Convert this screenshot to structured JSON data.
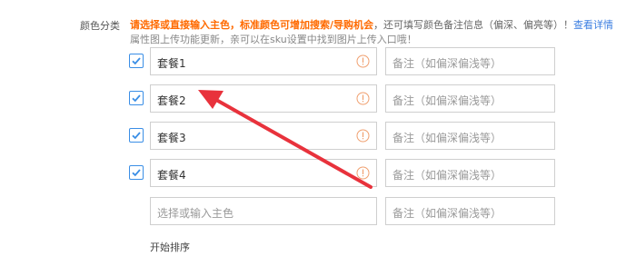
{
  "section": {
    "label": "颜色分类"
  },
  "notice": {
    "highlight": "请选择或直接输入主色，标准颜色可增加搜索/导购机会",
    "rest": "，还可填写颜色备注信息（偏深、偏亮等）！",
    "link": "查看详情",
    "line2": "属性图上传功能更新，亲可以在sku设置中找到图片上传入口哦！"
  },
  "rows": [
    {
      "checked": true,
      "value": "套餐1",
      "remark_placeholder": "备注（如偏深偏浅等）"
    },
    {
      "checked": true,
      "value": "套餐2",
      "remark_placeholder": "备注（如偏深偏浅等）"
    },
    {
      "checked": true,
      "value": "套餐3",
      "remark_placeholder": "备注（如偏深偏浅等）"
    },
    {
      "checked": true,
      "value": "套餐4",
      "remark_placeholder": "备注（如偏深偏浅等）"
    }
  ],
  "new_row": {
    "color_placeholder": "选择或输入主色",
    "remark_placeholder": "备注（如偏深偏浅等）"
  },
  "sort_label": "开始排序",
  "colors": {
    "accent_orange": "#ff6a00",
    "checkbox_blue": "#3a8ee6",
    "link_blue": "#3a7de0",
    "annotation_arrow": "#e8323c",
    "info_icon": "#f0a070"
  },
  "icons": {
    "check": "checkmark-icon",
    "info": "info-icon"
  }
}
